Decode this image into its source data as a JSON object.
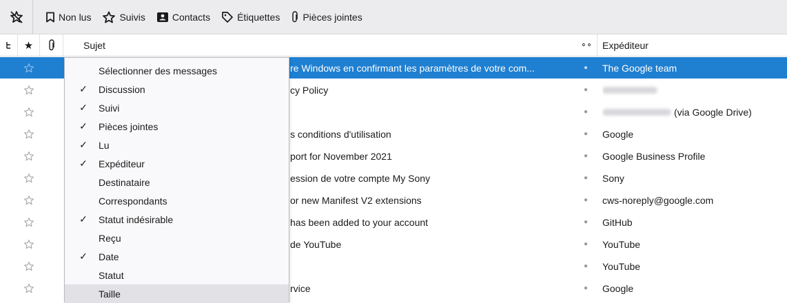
{
  "toolbar": {
    "items": [
      {
        "label": "Non lus",
        "icon": "bookmark-icon"
      },
      {
        "label": "Suivis",
        "icon": "star-icon"
      },
      {
        "label": "Contacts",
        "icon": "contact-card-icon"
      },
      {
        "label": "Étiquettes",
        "icon": "tag-icon"
      },
      {
        "label": "Pièces jointes",
        "icon": "paperclip-icon"
      }
    ]
  },
  "columns": {
    "subject": "Sujet",
    "sender": "Expéditeur"
  },
  "messages": [
    {
      "subject": "re Windows en confirmant les paramètres de votre com...",
      "sender": "The Google team",
      "selected": true
    },
    {
      "subject": "cy Policy",
      "sender": "",
      "sender_blurred": true
    },
    {
      "subject": "",
      "sender": "(via Google Drive)",
      "sender_blurred": true
    },
    {
      "subject": "s conditions d'utilisation",
      "sender": "Google"
    },
    {
      "subject": "port for November 2021",
      "sender": "Google Business Profile"
    },
    {
      "subject": "ession de votre compte My Sony",
      "sender": "Sony"
    },
    {
      "subject": "or new Manifest V2 extensions",
      "sender": "cws-noreply@google.com"
    },
    {
      "subject": "has been added to your account",
      "sender": "GitHub"
    },
    {
      "subject": "de YouTube",
      "sender": "YouTube"
    },
    {
      "subject": "",
      "sender": "YouTube"
    },
    {
      "subject": "rvice",
      "sender": "Google"
    }
  ],
  "column_menu": {
    "items": [
      {
        "label": "Sélectionner des messages",
        "checked": false
      },
      {
        "label": "Discussion",
        "checked": true
      },
      {
        "label": "Suivi",
        "checked": true
      },
      {
        "label": "Pièces jointes",
        "checked": true
      },
      {
        "label": "Lu",
        "checked": true
      },
      {
        "label": "Expéditeur",
        "checked": true
      },
      {
        "label": "Destinataire",
        "checked": false
      },
      {
        "label": "Correspondants",
        "checked": false
      },
      {
        "label": "Statut indésirable",
        "checked": true
      },
      {
        "label": "Reçu",
        "checked": false
      },
      {
        "label": "Date",
        "checked": true
      },
      {
        "label": "Statut",
        "checked": false
      },
      {
        "label": "Taille",
        "checked": false,
        "hovered": true
      }
    ],
    "check_glyph": "✓"
  },
  "colors": {
    "selection": "#1f7fd1",
    "toolbar_bg": "#ececee",
    "menu_bg": "#f9f9fb",
    "menu_hover": "#e1e1e6"
  }
}
